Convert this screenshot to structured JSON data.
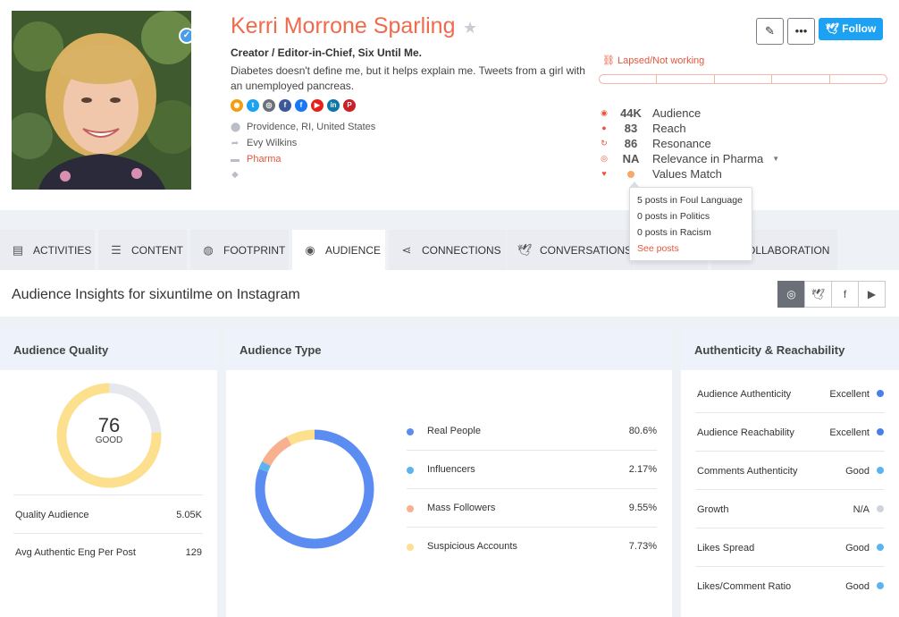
{
  "profile": {
    "name": "Kerri Morrone Sparling",
    "role": "Creator / Editor-in-Chief, Six Until Me.",
    "bio": "Diabetes doesn't define me, but it helps explain me. Tweets from a girl with an unemployed pancreas.",
    "location": "Providence, RI, United States",
    "owner": "Evy Wilkins",
    "category": "Pharma",
    "socials": [
      {
        "icon": "rss-icon",
        "color": "#f39c12",
        "glyph": "◉"
      },
      {
        "icon": "twitter-icon",
        "color": "#1da1f2",
        "glyph": "t"
      },
      {
        "icon": "instagram-icon",
        "color": "#6b6f77",
        "glyph": "◎"
      },
      {
        "icon": "facebook-icon",
        "color": "#3b5998",
        "glyph": "f"
      },
      {
        "icon": "facebook-page-icon",
        "color": "#1877f2",
        "glyph": "f"
      },
      {
        "icon": "youtube-icon",
        "color": "#e62117",
        "glyph": "▶"
      },
      {
        "icon": "linkedin-icon",
        "color": "#0e76a8",
        "glyph": "in"
      },
      {
        "icon": "pinterest-icon",
        "color": "#cb2027",
        "glyph": "P"
      }
    ]
  },
  "actions": {
    "follow_label": "Follow"
  },
  "status": {
    "lapsed_label": "Lapsed/Not working"
  },
  "metrics": [
    {
      "value": "44K",
      "label": "Audience",
      "icon": "eye-icon"
    },
    {
      "value": "83",
      "label": "Reach",
      "icon": "people-icon"
    },
    {
      "value": "86",
      "label": "Resonance",
      "icon": "refresh-icon"
    },
    {
      "value": "NA",
      "label": "Relevance in Pharma",
      "icon": "target-icon"
    },
    {
      "value": "",
      "label": "Values Match",
      "icon": "diamond-icon"
    }
  ],
  "values_tooltip": {
    "lines": [
      "5 posts in Foul Language",
      "0 posts in Politics",
      "0 posts in Racism"
    ],
    "link": "See posts"
  },
  "tabs": [
    {
      "label": "ACTIVITIES",
      "icon": "activities-icon"
    },
    {
      "label": "CONTENT",
      "icon": "content-list-icon"
    },
    {
      "label": "FOOTPRINT",
      "icon": "globe-icon"
    },
    {
      "label": "AUDIENCE",
      "icon": "eye-icon"
    },
    {
      "label": "CONNECTIONS",
      "icon": "share-icon"
    },
    {
      "label": "CONVERSATIONS",
      "icon": "twitter-icon"
    },
    {
      "label": "",
      "icon": ""
    },
    {
      "label": "OLLABORATION",
      "icon": ""
    }
  ],
  "active_tab": "AUDIENCE",
  "insights": {
    "title": "Audience Insights for sixuntilme on Instagram",
    "platforms": [
      "instagram-icon",
      "twitter-icon",
      "facebook-icon",
      "youtube-icon"
    ],
    "active_platform": "instagram-icon"
  },
  "audience_quality": {
    "title": "Audience Quality",
    "score": "76",
    "score_label": "GOOD",
    "score_fraction": 0.76,
    "colors": {
      "filled": "#fde08e",
      "track": "#e6e8ee"
    },
    "rows": [
      {
        "label": "Quality Audience",
        "value": "5.05K"
      },
      {
        "label": "Avg Authentic Eng Per Post",
        "value": "129"
      }
    ]
  },
  "audience_type": {
    "title": "Audience Type",
    "items": [
      {
        "label": "Real People",
        "value": "80.6%",
        "percent": 80.6,
        "color": "#5b8cf2"
      },
      {
        "label": "Influencers",
        "value": "2.17%",
        "percent": 2.17,
        "color": "#5cb3f0"
      },
      {
        "label": "Mass Followers",
        "value": "9.55%",
        "percent": 9.55,
        "color": "#f9b08f"
      },
      {
        "label": "Suspicious Accounts",
        "value": "7.73%",
        "percent": 7.73,
        "color": "#fde08e"
      }
    ]
  },
  "authenticity": {
    "title": "Authenticity & Reachability",
    "rows": [
      {
        "label": "Audience Authenticity",
        "value": "Excellent",
        "color": "#4a7fe8"
      },
      {
        "label": "Audience Reachability",
        "value": "Excellent",
        "color": "#4a7fe8"
      },
      {
        "label": "Comments Authenticity",
        "value": "Good",
        "color": "#5cb3f0"
      },
      {
        "label": "Growth",
        "value": "N/A",
        "color": "#d0d4da"
      },
      {
        "label": "Likes Spread",
        "value": "Good",
        "color": "#5cb3f0"
      },
      {
        "label": "Likes/Comment Ratio",
        "value": "Good",
        "color": "#5cb3f0"
      }
    ]
  }
}
